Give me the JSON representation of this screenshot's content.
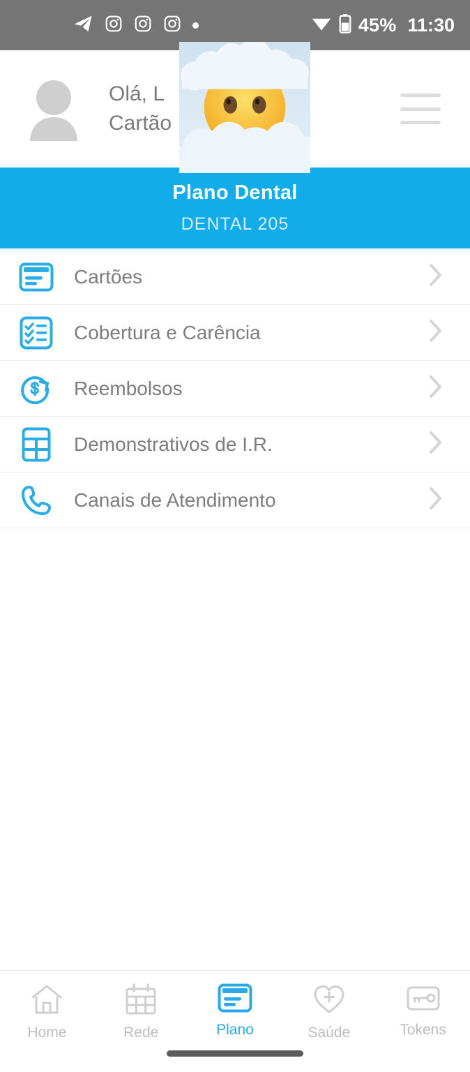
{
  "statusbar": {
    "notification_icons": [
      "telegram-icon",
      "instagram-icon",
      "instagram-icon",
      "instagram-icon",
      "more-notifications-dot"
    ],
    "wifi_icon": "wifi-icon",
    "battery_icon": "battery-icon",
    "battery_percent": "45%",
    "time": "11:30",
    "background_color": "#757575"
  },
  "header": {
    "avatar_icon": "user-avatar-placeholder",
    "greeting_line1": "Olá, L",
    "greeting_line2": "Cartão",
    "menu_icon": "hamburger-menu-icon"
  },
  "overlay": {
    "emoji_name": "face-in-clouds-emoji"
  },
  "banner": {
    "title": "Plano Dental",
    "subtitle": "DENTAL 205",
    "background_color": "#12aceb"
  },
  "menu": {
    "items": [
      {
        "label": "Cartões",
        "icon": "card-icon",
        "chevron": "chevron-right-icon"
      },
      {
        "label": "Cobertura e Carência",
        "icon": "checklist-icon",
        "chevron": "chevron-right-icon"
      },
      {
        "label": "Reembolsos",
        "icon": "refund-dollar-refresh-icon",
        "chevron": "chevron-right-icon"
      },
      {
        "label": "Demonstrativos de I.R.",
        "icon": "table-grid-icon",
        "chevron": "chevron-right-icon"
      },
      {
        "label": "Canais de Atendimento",
        "icon": "phone-icon",
        "chevron": "chevron-right-icon"
      }
    ],
    "accent_color": "#29ade4",
    "label_color": "#7d7d7d"
  },
  "bottomnav": {
    "active_color": "#2aa9e8",
    "inactive_color": "#bdbdbd",
    "items": [
      {
        "label": "Home",
        "icon": "home-icon",
        "active": false
      },
      {
        "label": "Rede",
        "icon": "calendar-grid-icon",
        "active": false
      },
      {
        "label": "Plano",
        "icon": "card-icon",
        "active": true
      },
      {
        "label": "Saúde",
        "icon": "heart-plus-icon",
        "active": false
      },
      {
        "label": "Tokens",
        "icon": "key-icon",
        "active": false
      }
    ]
  }
}
